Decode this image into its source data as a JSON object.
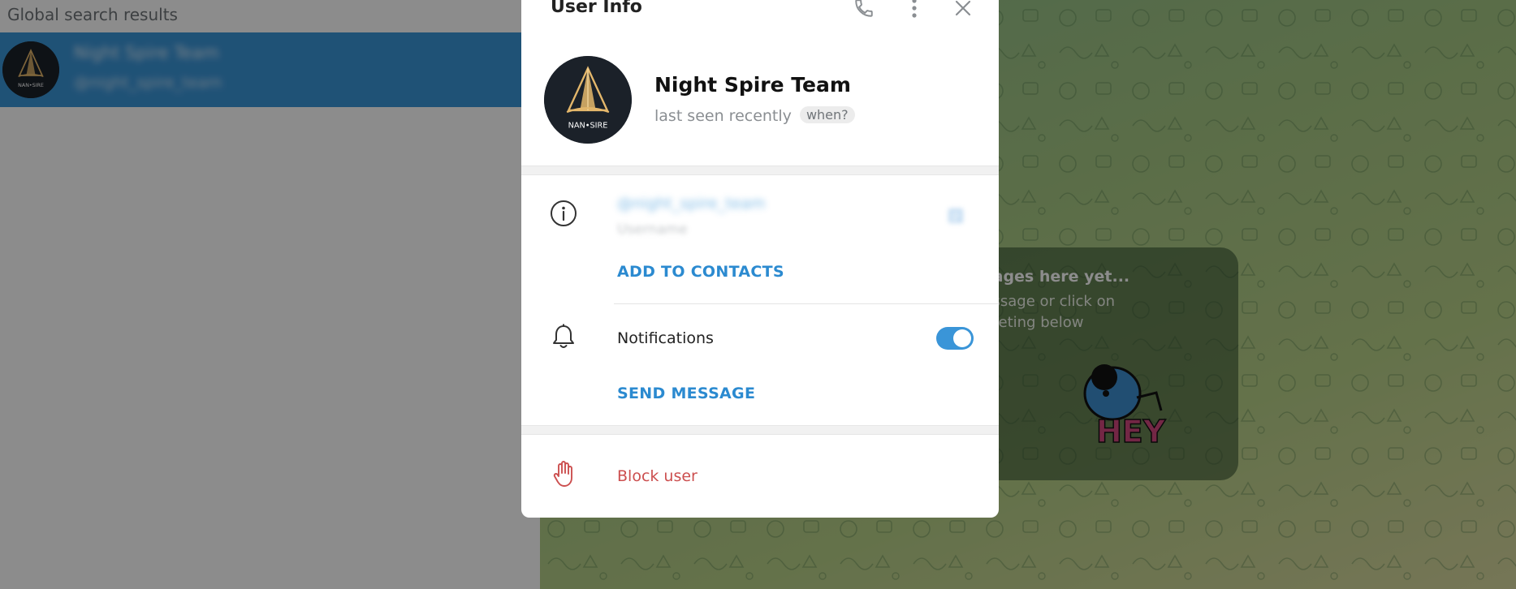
{
  "search_panel": {
    "header": "Global search results",
    "result": {
      "title": "Night Spire Team",
      "subtitle": "@night_spire_team",
      "avatar_icon": "night-spire-logo"
    }
  },
  "chat": {
    "empty_title": "ssages here yet...",
    "empty_line1": "nessage or click on",
    "empty_line2": "greeting below",
    "sticker_text": "HEY"
  },
  "dialog": {
    "title": "User Info",
    "header_icons": [
      "phone-icon",
      "more-vertical-icon",
      "close-icon"
    ],
    "profile": {
      "name": "Night Spire Team",
      "status": "last seen recently",
      "when_badge": "when?",
      "avatar_label": "NAN•SIRE"
    },
    "info": {
      "username": "@night_spire_team",
      "username_label": "Username",
      "add_contacts": "ADD TO CONTACTS"
    },
    "notifications": {
      "label": "Notifications",
      "enabled": true
    },
    "send_message": "SEND MESSAGE",
    "block_user": "Block user"
  },
  "colors": {
    "accent": "#3a95d8",
    "link": "#2b8ad0",
    "danger": "#cc4f4f",
    "selection": "#3a95d8"
  }
}
